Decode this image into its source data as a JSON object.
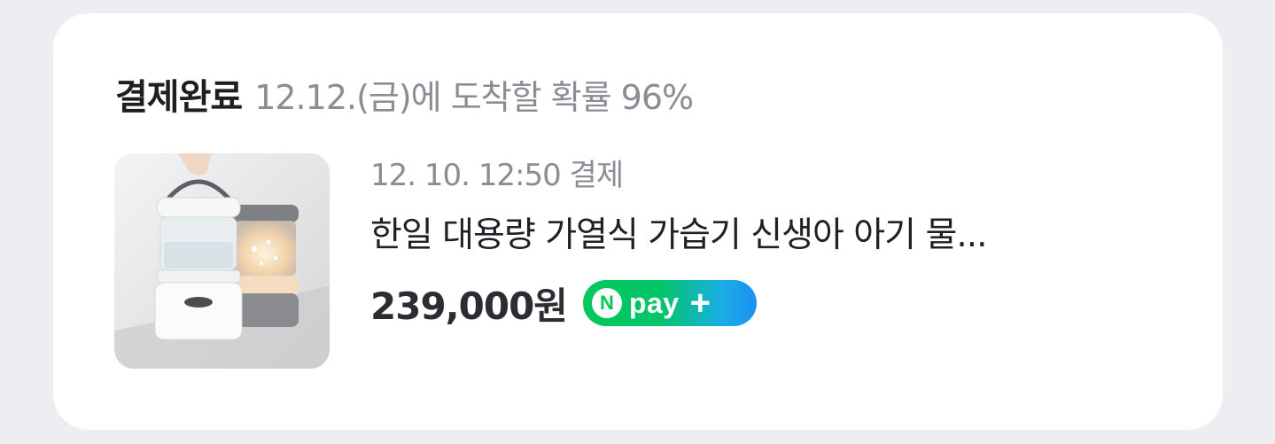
{
  "order_card": {
    "status": "결제완료",
    "delivery_estimate": "12.12.(금)에 도착할 확률 96%",
    "paid_at": "12. 10. 12:50 결제",
    "product_name": "한일 대용량 가열식 가습기 신생아 아기 물...",
    "price": "239,000원",
    "product_image_alt": "humidifier-product-photo"
  },
  "npay_badge": {
    "circle_letter": "N",
    "label": "pay",
    "plus": "+",
    "color_start": "#03c75a",
    "color_end": "#1e8ff2"
  },
  "colors": {
    "background": "#eceef2",
    "card": "#ffffff",
    "status_text": "#1e1e23",
    "secondary_text": "#8b8d94"
  }
}
